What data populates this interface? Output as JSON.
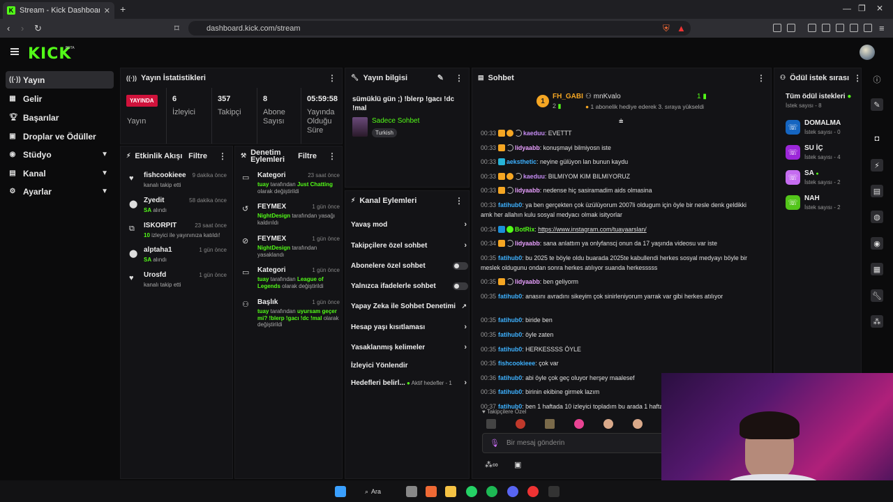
{
  "browser": {
    "tab_title": "Stream - Kick Dashboard",
    "url": "dashboard.kick.com/stream"
  },
  "app": {
    "logo": "KICK",
    "logo_tag": "BETA"
  },
  "sidebar": {
    "items": [
      {
        "label": "Yayın",
        "icon": "broadcast-icon",
        "active": true
      },
      {
        "label": "Gelir",
        "icon": "money-icon"
      },
      {
        "label": "Başarılar",
        "icon": "trophy-icon"
      },
      {
        "label": "Droplar ve Ödüller",
        "icon": "gift-icon"
      },
      {
        "label": "Stüdyo",
        "icon": "studio-icon",
        "expandable": true
      },
      {
        "label": "Kanal",
        "icon": "channel-icon",
        "expandable": true
      },
      {
        "label": "Ayarlar",
        "icon": "gear-icon",
        "expandable": true
      }
    ]
  },
  "stats": {
    "title": "Yayın İstatistikleri",
    "live_badge": "YAYINDA",
    "stream_label": "Yayın",
    "viewers_value": "6",
    "viewers_label": "İzleyici",
    "followers_value": "357",
    "followers_label": "Takipçi",
    "subs_value": "8",
    "subs_label": "Abone Sayısı",
    "uptime_value": "05:59:58",
    "uptime_label": "Yayında Olduğu Süre"
  },
  "stream_info": {
    "title": "Yayın bilgisi",
    "stream_title": "sümüklü gün ;) !blerp !gacı !dc !mal",
    "category": "Sadece Sohbet",
    "language": "Turkish"
  },
  "activity": {
    "title": "Etkinlik Akışı",
    "filter_label": "Filtre",
    "items": [
      {
        "icon": "heart-icon",
        "name": "fishcookieee",
        "time": "9 dakika önce",
        "desc": "kanalı takip etti"
      },
      {
        "icon": "subs-icon",
        "name": "Zyedit",
        "time": "58 dakika önce",
        "desc_pre": "SA",
        "desc": " alındı"
      },
      {
        "icon": "raid-icon",
        "name": "ISKORPIT",
        "time": "23 saat önce",
        "desc_pre": "10",
        "desc": " izleyici ile yayınınıza katıldı!"
      },
      {
        "icon": "subs-icon",
        "name": "alptaha1",
        "time": "1 gün önce",
        "desc_pre": "SA",
        "desc": " alındı"
      },
      {
        "icon": "heart-icon",
        "name": "Urosfd",
        "time": "1 gün önce",
        "desc": "kanalı takip etti"
      }
    ]
  },
  "moderation": {
    "title": "Denetim Eylemleri",
    "filter_label": "Filtre",
    "items": [
      {
        "icon": "category-icon",
        "title": "Kategori",
        "time": "23 saat önce",
        "actor": "tuay",
        "mid": " tarafından ",
        "target": "Just Chatting",
        "tail": " olarak değiştirildi"
      },
      {
        "icon": "unban-icon",
        "title": "FEYMEX",
        "time": "1 gün önce",
        "actor": "NightDesign",
        "mid": " tarafından yasağı kaldırıldı",
        "target": "",
        "tail": ""
      },
      {
        "icon": "ban-icon",
        "title": "FEYMEX",
        "time": "1 gün önce",
        "actor": "NightDesign",
        "mid": " tarafından yasaklandı",
        "target": "",
        "tail": ""
      },
      {
        "icon": "category-icon",
        "title": "Kategori",
        "time": "1 gün önce",
        "actor": "tuay",
        "mid": " tarafından ",
        "target": "League of Legends",
        "tail": " olarak değiştirildi"
      },
      {
        "icon": "title-icon",
        "title": "Başlık",
        "time": "1 gün önce",
        "actor": "tuay",
        "mid": " tarafından ",
        "target": "uyursam geçer mi? !blerp !gacı !dc !mal",
        "tail": " olarak değiştirildi"
      }
    ]
  },
  "channel_actions": {
    "title": "Kanal Eylemleri",
    "items": [
      {
        "label": "Yavaş mod",
        "type": "arrow"
      },
      {
        "label": "Takipçilere özel sohbet",
        "type": "arrow"
      },
      {
        "label": "Abonelere özel sohbet",
        "type": "toggle"
      },
      {
        "label": "Yalnızca ifadelerle sohbet",
        "type": "toggle"
      },
      {
        "label": "Yapay Zeka ile Sohbet Denetimi",
        "type": "external"
      },
      {
        "label": "Hesap yaşı kısıtlaması",
        "type": "arrow"
      },
      {
        "label": "Yasaklanmış kelimeler",
        "type": "arrow"
      },
      {
        "label": "İzleyici Yönlendir",
        "type": "none"
      },
      {
        "label": "Hedefleri belirl...",
        "type": "arrow",
        "status": "Aktif hedefler - 1"
      }
    ]
  },
  "chat": {
    "title": "Sohbet",
    "top_user": "FH_GABI",
    "top_user_count": "2",
    "gifter": "mnKvalo",
    "gifter_count": "1",
    "gifter_msg": "1 abonelik hediye ederek 3. sıraya yükseldi",
    "messages": [
      {
        "time": "00:33",
        "badges": [
          "crown",
          "one",
          "moon"
        ],
        "user": "kaeduu",
        "color": "cpurple",
        "text": "EVETTT"
      },
      {
        "time": "00:33",
        "badges": [
          "crown",
          "moon"
        ],
        "user": "lidyaabb",
        "color": "cpink",
        "text": "konuşmayi bilmiyosn iste"
      },
      {
        "time": "00:33",
        "badges": [
          "grid"
        ],
        "user": "aeksthetic",
        "color": "cblue",
        "text": "neyine gülüyon lan bunun kaydu"
      },
      {
        "time": "00:33",
        "badges": [
          "crown",
          "one",
          "moon"
        ],
        "user": "kaeduu",
        "color": "cpurple",
        "text": "BILMIYOM KIM BILMIYORUZ"
      },
      {
        "time": "00:33",
        "badges": [
          "crown",
          "moon"
        ],
        "user": "lidyaabb",
        "color": "cpink",
        "text": "nedense hiç sasiramadim aids olmasina"
      },
      {
        "time": "00:33",
        "badges": [],
        "user": "fatihub0",
        "color": "cblue",
        "text": "ya ben gerçekten çok üzülüyorum 2007li oldugum için öyle bir nesle denk geldikki amk her allahın kulu sosyal medyacı olmak isityorlar"
      },
      {
        "time": "00:34",
        "badges": [
          "bot",
          "green"
        ],
        "user": "BotRix",
        "color": "cgreen",
        "text": "https://www.instagram.com/tuayaarslan/",
        "link": true
      },
      {
        "time": "00:34",
        "badges": [
          "crown",
          "moon"
        ],
        "user": "lidyaabb",
        "color": "cpink",
        "text": "sana anlattım ya onlyfanscj onun da 17 yaşında videosu var iste"
      },
      {
        "time": "00:35",
        "badges": [],
        "user": "fatihub0",
        "color": "cblue",
        "text": "bu 2025 te böyle oldu buarada 2025te kabullendi herkes sosyal medyayı böyle bir meslek oldugunu ondan sonra herkes atılıyor suanda herkesssss"
      },
      {
        "time": "00:35",
        "badges": [
          "crown",
          "moon"
        ],
        "user": "lidyaabb",
        "color": "cpink",
        "text": "ben geliyorm"
      },
      {
        "time": "00:35",
        "badges": [],
        "user": "fatihub0",
        "color": "cblue",
        "text": "anasını avradını sikeyim çok sinirleniyorum yarrak var gibi herkes atılıyor"
      },
      {
        "time": "00:35",
        "badges": [],
        "user": "fatihub0",
        "color": "cblue",
        "text": "biride ben"
      },
      {
        "time": "00:35",
        "badges": [],
        "user": "fatihub0",
        "color": "cblue",
        "text": "öyle zaten"
      },
      {
        "time": "00:35",
        "badges": [],
        "user": "fatihub0",
        "color": "cblue",
        "text": "HERKESSSS ÖYLE"
      },
      {
        "time": "00:35",
        "badges": [],
        "user": "fishcookieee",
        "color": "cblue",
        "text": "çok var"
      },
      {
        "time": "00:36",
        "badges": [],
        "user": "fatihub0",
        "color": "cblue",
        "text": "abi öyle çok geç oluyor herşey maalesef"
      },
      {
        "time": "00:36",
        "badges": [],
        "user": "fatihub0",
        "color": "cblue",
        "text": "birinin ekibine girmek lazım"
      },
      {
        "time": "00:37",
        "badges": [],
        "user": "fatihub0",
        "color": "cblue",
        "text": "ben 1 haftada 10 izleyici topladım bu arada 1 hafta"
      }
    ],
    "followers_only": "Takipçilere Özel",
    "input_placeholder": "Bir mesaj gönderin"
  },
  "rewards": {
    "title": "Ödül istek sırası",
    "all_label": "Tüm ödül istekleri",
    "all_count": "İstek sayısı - 8",
    "items": [
      {
        "name": "DOMALMA",
        "count": "İstek sayısı - 0",
        "color": "#1565c0",
        "dot": false
      },
      {
        "name": "SU İÇ",
        "count": "İstek sayısı - 4",
        "color": "#9c27d9",
        "dot": false
      },
      {
        "name": "SA",
        "count": "İstek sayısı - 2",
        "color": "#c56cf0",
        "dot": true
      },
      {
        "name": "NAH",
        "count": "İstek sayısı - 2",
        "color": "#53c51a",
        "dot": false
      }
    ]
  },
  "taskbar": {
    "search_label": "Ara"
  }
}
